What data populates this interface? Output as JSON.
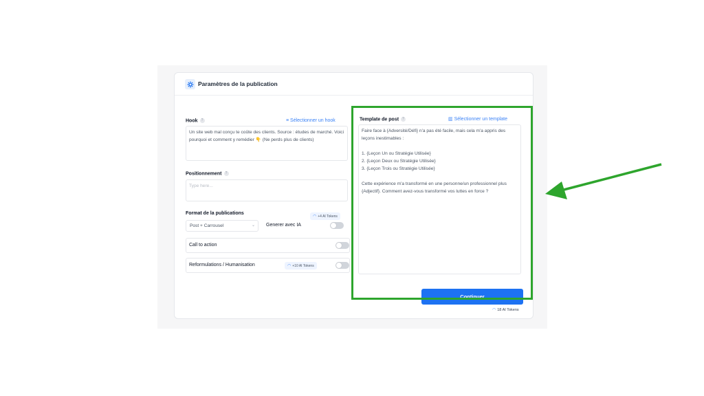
{
  "header": {
    "title": "Paramètres de la publication",
    "icon": "gear-icon"
  },
  "hook": {
    "label": "Hook",
    "select_link": "Sélectionner un hook",
    "value": "Un site web mal conçu te coûte des clients. Source : études de marché. Voici pourquoi et comment y remédier 👇 (Ne perds plus de clients)"
  },
  "positioning": {
    "label": "Positionnement",
    "placeholder": "Type here..."
  },
  "format": {
    "label": "Format de la publications",
    "token_badge": "+4 AI Tokens",
    "selected": "Post + Carrousel",
    "ai_label": "Generer avec IA"
  },
  "cta": {
    "label": "Call to action"
  },
  "reformulation": {
    "label": "Reformulations / Humanisation",
    "token_badge": "+10 AI Tokens"
  },
  "template": {
    "label": "Template de post",
    "select_link": "Sélectionner un template",
    "value": "Faire face à {Adversité/Défi} n'a pas été facile, mais cela m'a appris des leçons inestimables :\n\n1. {Leçon Un ou Stratégie Utilisée}\n2. {Leçon Deux ou Stratégie Utilisée}\n3. {Leçon Trois ou Stratégie Utilisée}\n\nCette expérience m'a transformé en une personne/un professionnel plus {Adjectif}. Comment avez-vous transformé vos luttes en force ?"
  },
  "continue_button": "Continuer",
  "total_tokens": "18 AI Tokens",
  "colors": {
    "accent": "#1d72f2",
    "highlight": "#2ea52d",
    "link": "#3b82f6"
  }
}
